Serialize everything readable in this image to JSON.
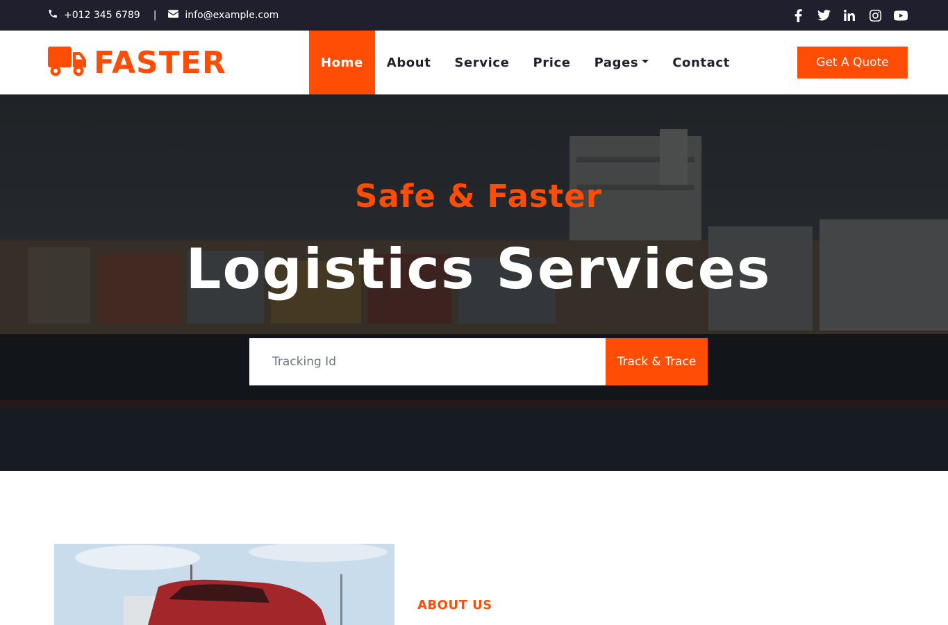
{
  "topbar": {
    "phone": "+012 345 6789",
    "separator": "|",
    "email": "info@example.com",
    "social_icons": [
      "facebook-icon",
      "twitter-icon",
      "linkedin-icon",
      "instagram-icon",
      "youtube-icon"
    ]
  },
  "brand": {
    "name": "FASTER",
    "logo_icon": "truck-icon"
  },
  "nav": {
    "items": [
      {
        "label": "Home",
        "active": true
      },
      {
        "label": "About"
      },
      {
        "label": "Service"
      },
      {
        "label": "Price"
      },
      {
        "label": "Pages",
        "dropdown": true
      },
      {
        "label": "Contact"
      }
    ],
    "quote_button": "Get A Quote"
  },
  "hero": {
    "subtitle": "Safe & Faster",
    "title": "Logistics Services",
    "tracking_placeholder": "Tracking Id",
    "track_button": "Track & Trace"
  },
  "about": {
    "label": "ABOUT US"
  },
  "colors": {
    "accent": "#ff4d06",
    "dark": "#1f1f2e",
    "white": "#ffffff"
  }
}
